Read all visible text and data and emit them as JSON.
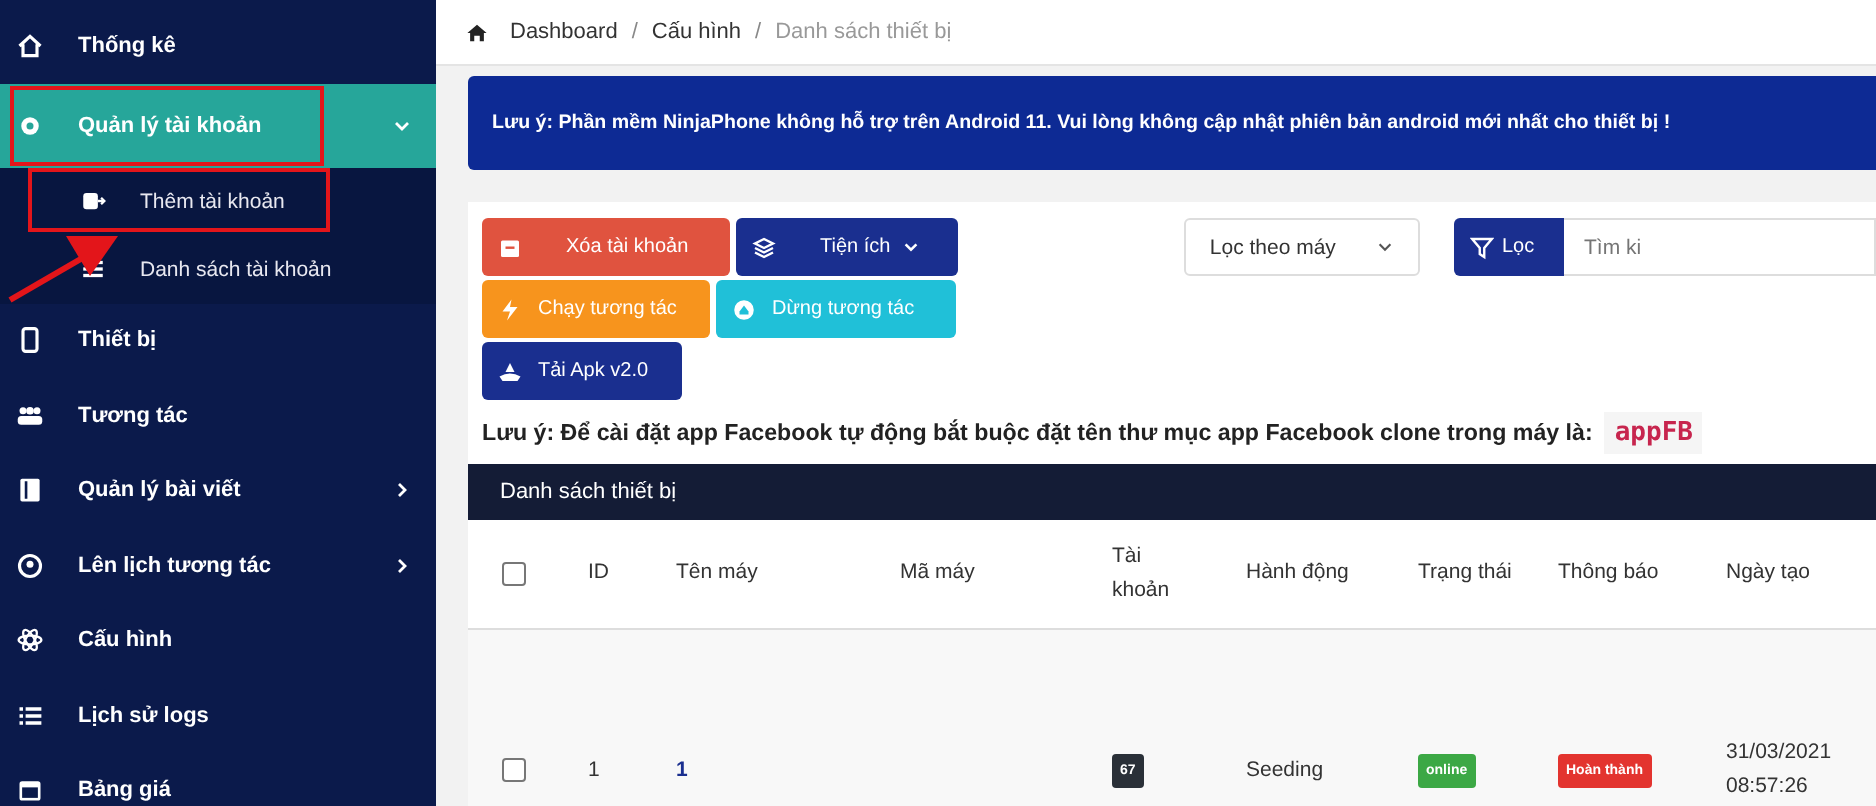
{
  "sidebar": {
    "items": [
      {
        "label": "Thống kê",
        "selected": false,
        "highlighted": false
      },
      {
        "label": "Quản lý tài khoản",
        "selected": true,
        "highlighted": true,
        "expanded": true,
        "children": [
          {
            "label": "Thêm tài khoản",
            "highlighted": true
          },
          {
            "label": "Danh sách tài khoản",
            "highlighted": false
          }
        ]
      },
      {
        "label": "Thiết bị",
        "selected": false,
        "highlighted": false
      },
      {
        "label": "Tương tác",
        "selected": false,
        "highlighted": false
      },
      {
        "label": "Quản lý bài viết",
        "selected": false,
        "highlighted": false,
        "expanded": false
      },
      {
        "label": "Lên lịch tương tác",
        "selected": false,
        "highlighted": false,
        "expanded": false
      },
      {
        "label": "Cấu hình",
        "selected": false,
        "highlighted": false
      },
      {
        "label": "Lịch sử logs",
        "selected": false,
        "highlighted": false
      },
      {
        "label": "Bảng giá",
        "selected": false,
        "highlighted": false
      }
    ],
    "annotation_arrow": true
  },
  "breadcrumb": {
    "separator": "/",
    "items": [
      {
        "label": "Dashboard",
        "current": false
      },
      {
        "label": "Cấu hình",
        "current": false
      },
      {
        "label": "Danh sách thiết bị",
        "current": true
      }
    ]
  },
  "alert": "Lưu ý: Phần mềm NinjaPhone không hỗ trợ trên Android 11. Vui lòng không cập nhật phiên bản android mới nhất cho thiết bị !",
  "toolbar": {
    "buttons": [
      {
        "label": "Xóa tài khoản",
        "kind": "danger"
      },
      {
        "label": "Tiện ích",
        "kind": "dropdown"
      },
      {
        "label": "Chạy tương tác",
        "kind": "warning"
      },
      {
        "label": "Dừng tương tác",
        "kind": "info"
      },
      {
        "label": "Tải Apk v2.0",
        "kind": "primary"
      }
    ],
    "machine_filter": {
      "value": "Lọc theo máy"
    },
    "filter_button": "Lọc",
    "search": {
      "placeholder": "Tìm ki"
    }
  },
  "note": {
    "text": "Lưu ý: Để cài đặt app Facebook tự động bắt buộc đặt tên thư mục app Facebook clone trong máy là:",
    "code": "appFB"
  },
  "table": {
    "title": "Danh sách thiết bị",
    "select_all_checked": false,
    "columns": [
      "ID",
      "Tên máy",
      "Mã máy",
      "Tài khoản",
      "Hành động",
      "Trạng thái",
      "Thông báo",
      "Ngày tạo"
    ],
    "rows": [
      {
        "checked": false,
        "id": "1",
        "name": "1",
        "accounts": "67",
        "action": "Seeding",
        "status": "online",
        "notice": "Hoàn thành",
        "created_date": "31/03/2021",
        "created_time": "08:57:26"
      }
    ]
  }
}
